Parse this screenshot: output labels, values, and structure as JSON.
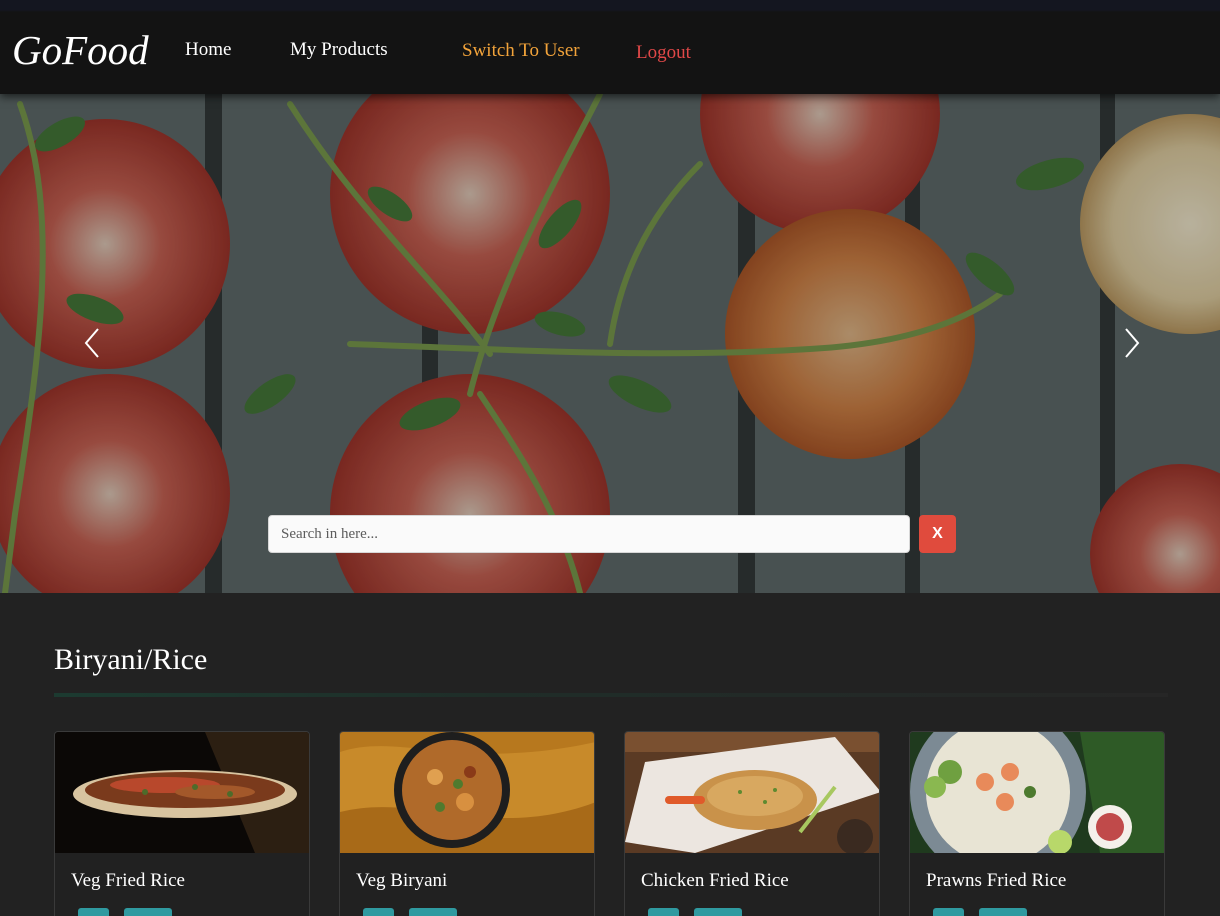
{
  "navbar": {
    "brand": "GoFood",
    "links": {
      "home": "Home",
      "my_products": "My Products",
      "switch": "Switch To User",
      "logout": "Logout"
    },
    "colors": {
      "switch": "#f2a33a",
      "logout": "#e04848"
    }
  },
  "hero": {
    "search_placeholder": "Search in here...",
    "clear_label": "X",
    "prev_icon": "chevron-left-icon",
    "next_icon": "chevron-right-icon"
  },
  "category": {
    "title": "Biryani/Rice",
    "items": [
      {
        "name": "Veg Fried Rice"
      },
      {
        "name": "Veg Biryani"
      },
      {
        "name": "Chicken Fried Rice"
      },
      {
        "name": "Prawns Fried Rice"
      }
    ]
  },
  "colors": {
    "background": "#222222",
    "button": "#2f9aa0",
    "clear_button": "#e04b3d"
  }
}
